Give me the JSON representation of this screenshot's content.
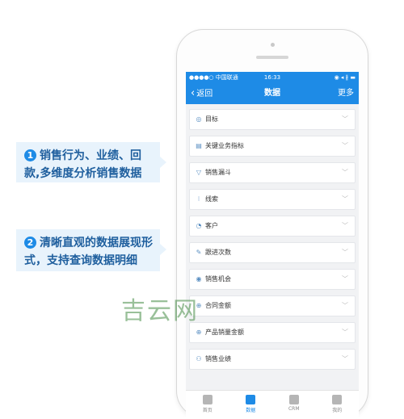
{
  "callouts": [
    {
      "num": "1",
      "text": "销售行为、业绩、回款,多维度分析销售数据"
    },
    {
      "num": "2",
      "text": "清晰直观的数据展现形式，支持查询数据明细"
    }
  ],
  "status_bar": {
    "carrier": "●●●●○ 中国联通",
    "time": "16:33",
    "battery": "◉ ◂ ∦ ▬"
  },
  "navbar": {
    "back": "返回",
    "title": "数据",
    "more": "更多"
  },
  "list_items": [
    {
      "label": "目标",
      "icon": "target-icon",
      "glyph": "◎"
    },
    {
      "label": "关键业务指标",
      "icon": "chart-icon",
      "glyph": "▤"
    },
    {
      "label": "销售漏斗",
      "icon": "funnel-icon",
      "glyph": "▽"
    },
    {
      "label": "线索",
      "icon": "leads-icon",
      "glyph": "⁝"
    },
    {
      "label": "客户",
      "icon": "customer-icon",
      "glyph": "◔"
    },
    {
      "label": "跟进次数",
      "icon": "followup-icon",
      "glyph": "✎"
    },
    {
      "label": "销售机会",
      "icon": "opportunity-icon",
      "glyph": "◉"
    },
    {
      "label": "合同金额",
      "icon": "contract-icon",
      "glyph": "⊕"
    },
    {
      "label": "产品销量金额",
      "icon": "product-sales-icon",
      "glyph": "⊕"
    },
    {
      "label": "销售业绩",
      "icon": "performance-icon",
      "glyph": "⚇"
    }
  ],
  "tabs": [
    {
      "label": "首页",
      "icon": "home-icon",
      "active": false
    },
    {
      "label": "数据",
      "icon": "data-icon",
      "active": true
    },
    {
      "label": "CRM",
      "icon": "crm-icon",
      "active": false
    },
    {
      "label": "我的",
      "icon": "profile-icon",
      "active": false
    }
  ],
  "watermark": "吉云网",
  "colors": {
    "accent": "#1e8be6",
    "callout_bg": "#e8f3fc",
    "callout_text": "#1f5f9e"
  }
}
